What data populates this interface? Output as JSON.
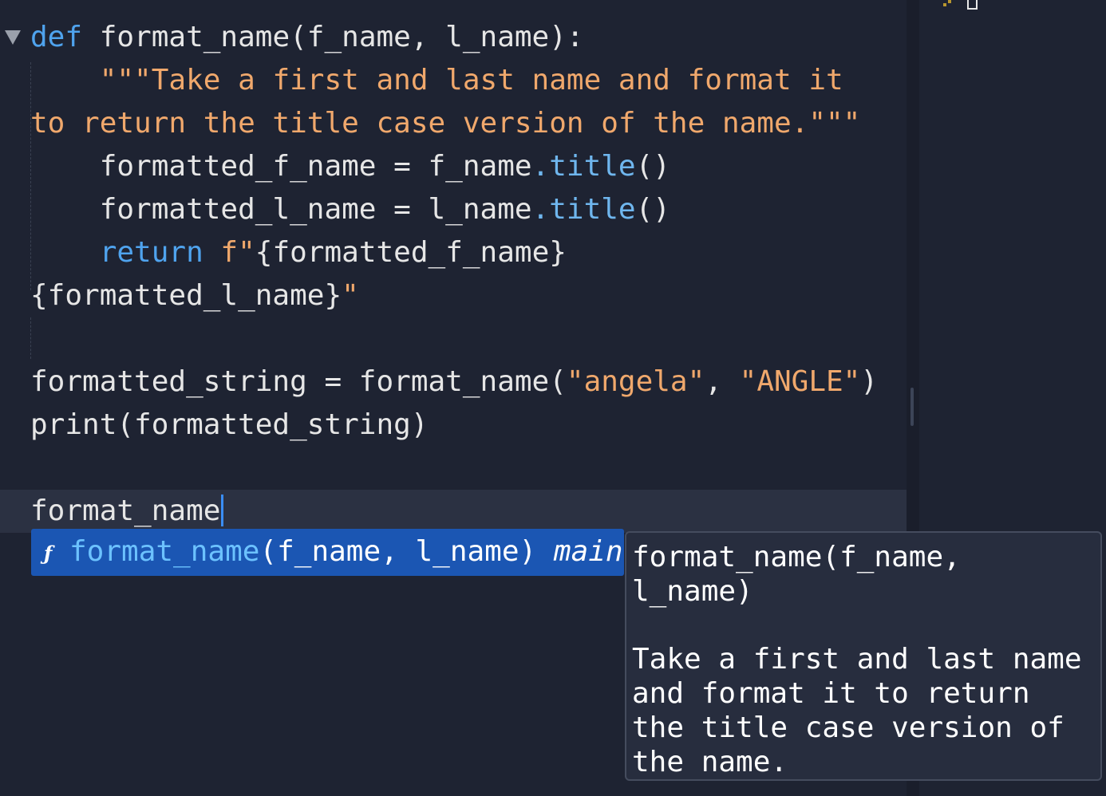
{
  "code": {
    "line1": {
      "kw": "def",
      "rest": " format_name(f_name, l_name):"
    },
    "line2": {
      "indent": "    ",
      "str": "\"\"\"Take a first and last name and format it"
    },
    "line3": {
      "str": "to return the title case version of the name.\"\"\""
    },
    "line4": {
      "indent": "    ",
      "lhs": "formatted_f_name = f_name",
      "meth": ".title",
      "tail": "()"
    },
    "line5": {
      "indent": "    ",
      "lhs": "formatted_l_name = l_name",
      "meth": ".title",
      "tail": "()"
    },
    "line6": {
      "indent": "    ",
      "kw": "return",
      "fprefix": " f\"",
      "expr": "{formatted_f_name}"
    },
    "line7": {
      "expr": "{formatted_l_name}",
      "str": "\""
    },
    "line9": {
      "head": "formatted_string = format_name(",
      "arg1": "\"angela\"",
      "sep": ", ",
      "arg2": "\"ANGLE\"",
      "tail": ")"
    },
    "line10": {
      "text": "print(formatted_string)"
    },
    "line12": {
      "text": "format_name"
    }
  },
  "autocomplete": {
    "icon": "function-icon",
    "icon_glyph": "ƒ",
    "name": "format_name",
    "signature": "(f_name, l_name)",
    "module": "main"
  },
  "doc_popup": {
    "signature": "format_name(f_name,\nl_name)",
    "description": "Take a first and last name\nand format it to return\nthe title case version of\nthe name."
  }
}
